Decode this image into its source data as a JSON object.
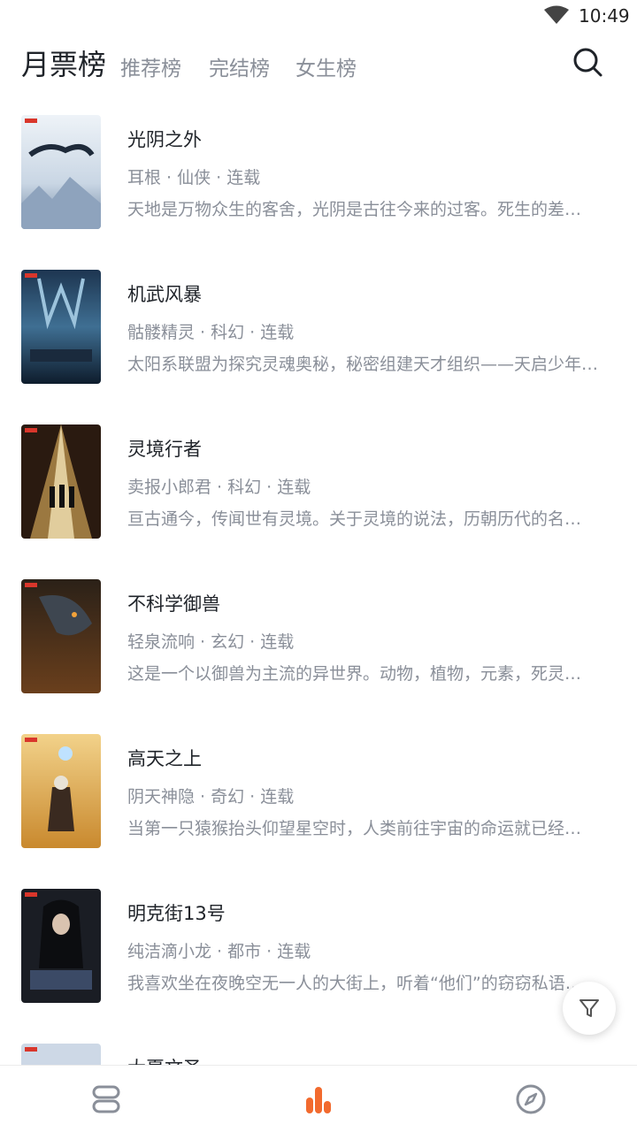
{
  "status_bar": {
    "time": "10:49",
    "wifi_icon": "wifi-icon"
  },
  "header": {
    "tabs": [
      {
        "label": "月票榜",
        "active": true
      },
      {
        "label": "推荐榜",
        "active": false
      },
      {
        "label": "完结榜",
        "active": false
      },
      {
        "label": "女生榜",
        "active": false
      }
    ],
    "search_icon": "search-icon"
  },
  "books": [
    {
      "title": "光阴之外",
      "meta": "耳根 · 仙侠 · 连载",
      "desc": "天地是万物众生的客舍，光阴是古往今来的过客。死生的差…"
    },
    {
      "title": "机武风暴",
      "meta": "骷髅精灵 · 科幻 · 连载",
      "desc": "太阳系联盟为探究灵魂奥秘，秘密组建天才组织——天启少年…"
    },
    {
      "title": "灵境行者",
      "meta": "卖报小郎君 · 科幻 · 连载",
      "desc": "亘古通今，传闻世有灵境。关于灵境的说法，历朝历代的名…"
    },
    {
      "title": "不科学御兽",
      "meta": "轻泉流响 · 玄幻 · 连载",
      "desc": "这是一个以御兽为主流的异世界。动物，植物，元素，死灵…"
    },
    {
      "title": "高天之上",
      "meta": "阴天神隐 · 奇幻 · 连载",
      "desc": "当第一只猿猴抬头仰望星空时，人类前往宇宙的命运就已经…"
    },
    {
      "title": "明克街13号",
      "meta": "纯洁滴小龙 · 都市 · 连载",
      "desc": "我喜欢坐在夜晚空无一人的大街上，听着“他们”的窃窃私语…"
    },
    {
      "title": "大夏文圣",
      "meta": "",
      "desc": ""
    }
  ],
  "filter_button": {
    "icon": "filter-icon"
  },
  "bottom_nav": [
    {
      "icon": "bookshelf-icon",
      "active": false
    },
    {
      "icon": "ranking-icon",
      "active": true
    },
    {
      "icon": "discover-compass-icon",
      "active": false
    }
  ],
  "colors": {
    "accent": "#f26a2e",
    "text_primary": "#1f2329",
    "text_secondary": "#8a8f99"
  }
}
